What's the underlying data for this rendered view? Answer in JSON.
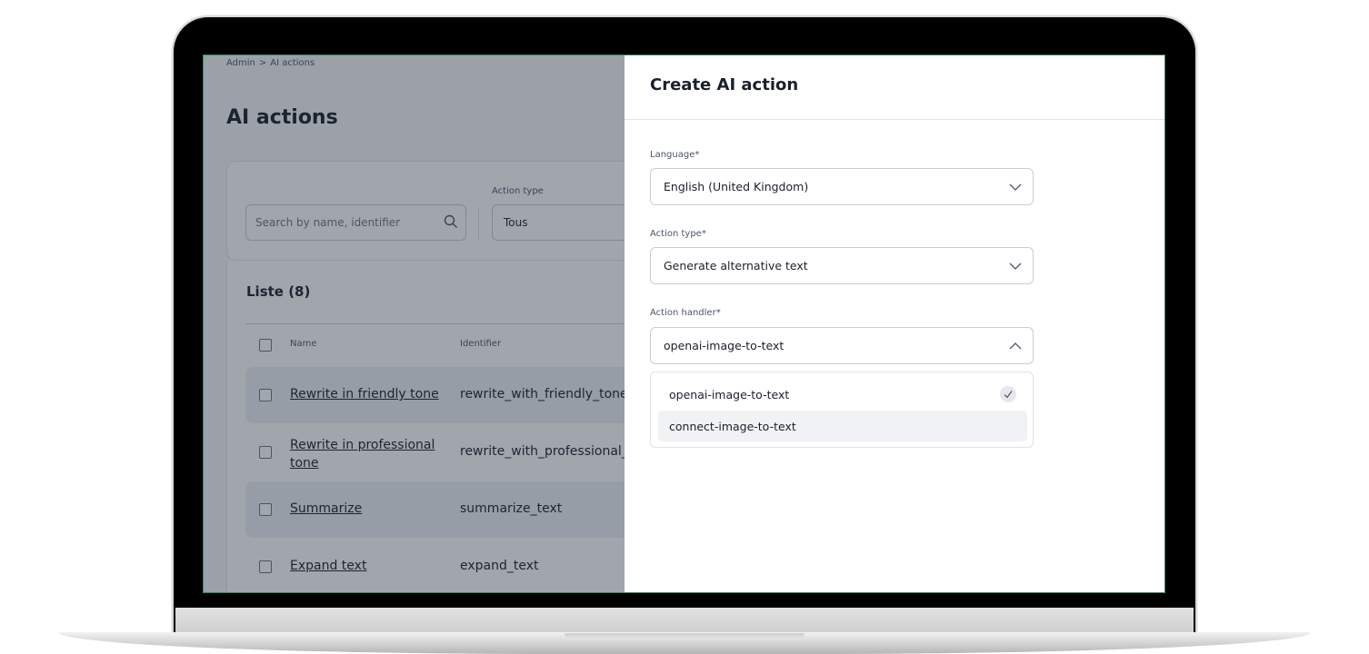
{
  "breadcrumb": {
    "items": [
      "Admin",
      ">",
      "AI actions"
    ]
  },
  "page": {
    "title": "AI actions"
  },
  "filters": {
    "search_placeholder": "Search by name, identifier",
    "action_type_label": "Action type",
    "action_type_value": "Tous"
  },
  "list": {
    "title": "Liste (8)",
    "columns": {
      "name": "Name",
      "identifier": "Identifier"
    },
    "rows": [
      {
        "name": "Rewrite in friendly tone",
        "identifier": "rewrite_with_friendly_tone"
      },
      {
        "name": "Rewrite in professional tone",
        "identifier": "rewrite_with_professional_tc"
      },
      {
        "name": "Summarize",
        "identifier": "summarize_text"
      },
      {
        "name": "Expand text",
        "identifier": "expand_text"
      }
    ]
  },
  "drawer": {
    "title": "Create AI action",
    "language": {
      "label": "Language*",
      "value": "English (United Kingdom)"
    },
    "action_type": {
      "label": "Action type*",
      "value": "Generate alternative text"
    },
    "action_handler": {
      "label": "Action handler*",
      "value": "openai-image-to-text",
      "options": [
        {
          "label": "openai-image-to-text",
          "selected": true
        },
        {
          "label": "connect-image-to-text",
          "selected": false
        }
      ]
    }
  },
  "colors": {
    "frame_accent": "#2f8a5a",
    "overlay": "#1e2a3c"
  }
}
